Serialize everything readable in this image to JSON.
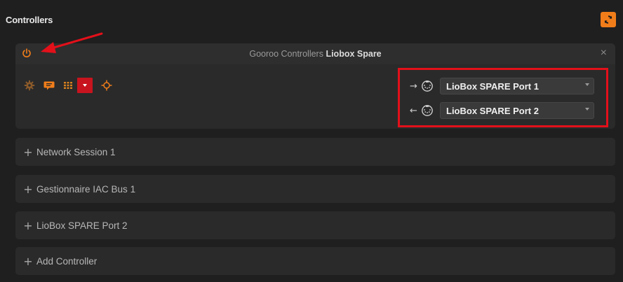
{
  "header": {
    "title": "Controllers",
    "refresh_icon": "refresh-icon"
  },
  "panel": {
    "title_prefix": "Gooroo Controllers",
    "title_name": "Liobox Spare",
    "close_symbol": "×",
    "ports": {
      "output": {
        "direction_symbol": "→",
        "value": "LioBox SPARE Port 1"
      },
      "input": {
        "direction_symbol": "←",
        "value": "LioBox SPARE Port 2"
      }
    }
  },
  "collapsed": [
    {
      "symbol": "+",
      "label": "Network Session 1"
    },
    {
      "symbol": "+",
      "label": "Gestionnaire IAC Bus 1"
    },
    {
      "symbol": "+",
      "label": "LioBox SPARE Port 2"
    },
    {
      "symbol": "+",
      "label": "Add Controller"
    }
  ],
  "colors": {
    "accent": "#f07d1a",
    "highlight": "#e3101a",
    "red_button": "#c8141e"
  }
}
